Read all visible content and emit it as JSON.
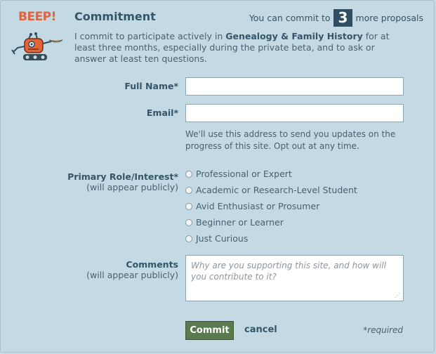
{
  "brand": "BEEP!",
  "header": {
    "title": "Commitment",
    "remaining_prefix": "You can commit to",
    "remaining_count": "3",
    "remaining_suffix": "more proposals"
  },
  "pledge": {
    "part1": "I commit to participate actively in",
    "site_name": "Genealogy & Family History",
    "part2": "for at least three months, especially during the private beta, and to ask or answer at least ten questions."
  },
  "form": {
    "full_name_label": "Full Name*",
    "full_name_value": "",
    "email_label": "Email*",
    "email_value": "",
    "email_hint": "We'll use this address to send you updates on the progress of this site. Opt out at any time.",
    "role_label": "Primary Role/Interest*",
    "role_sublabel": "(will appear publicly)",
    "roles": [
      "Professional or Expert",
      "Academic or Research-Level Student",
      "Avid Enthusiast or Prosumer",
      "Beginner or Learner",
      "Just Curious"
    ],
    "comments_label": "Comments",
    "comments_sublabel": "(will appear publicly)",
    "comments_placeholder": "Why are you supporting this site, and how will you contribute to it?"
  },
  "actions": {
    "commit_label": "Commit",
    "cancel_label": "cancel",
    "required_note": "*required"
  },
  "colors": {
    "background": "#c3d9e4",
    "brand": "#e2643a",
    "commit_button": "#587a4e",
    "count_badge": "#2f4e64"
  }
}
